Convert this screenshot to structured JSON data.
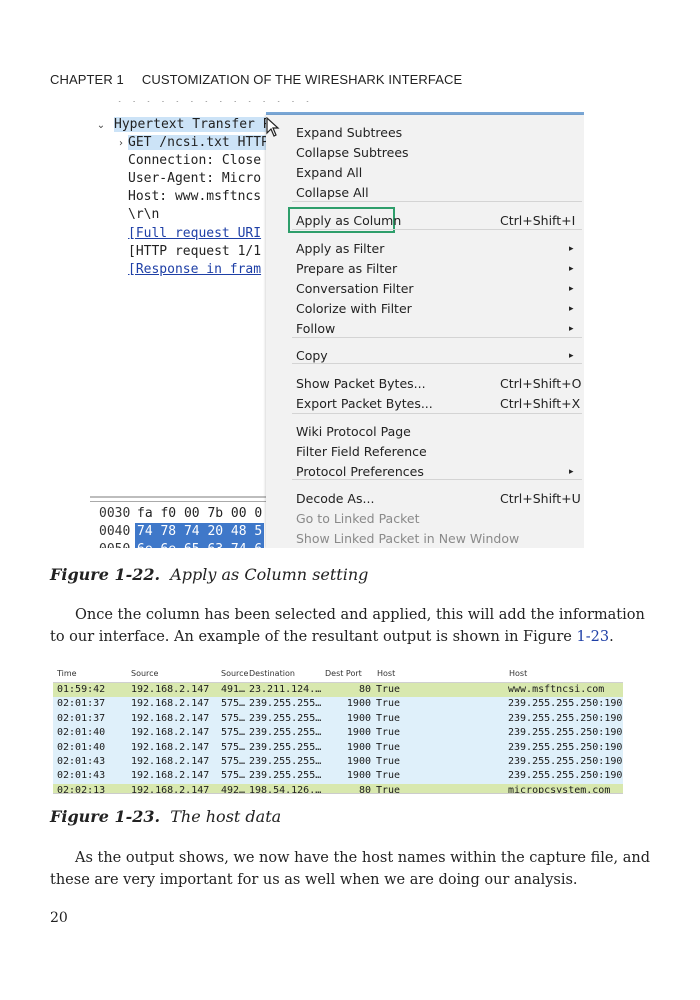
{
  "header": {
    "chapter": "CHAPTER 1",
    "title": "CUSTOMIZATION OF THE WIRESHARK INTERFACE"
  },
  "figure1": {
    "tree_cut_row": "· · · · · · · · · · · · · ·",
    "tree": [
      {
        "arrow": "⌄",
        "text": "Hypertext Transfer P"
      },
      {
        "arrow": "›",
        "text": "GET /ncsi.txt HTTP"
      },
      {
        "arrow": "",
        "text": "Connection: Close"
      },
      {
        "arrow": "",
        "text": "User-Agent: Micro"
      },
      {
        "arrow": "",
        "text": "Host: www.msftncs"
      },
      {
        "arrow": "",
        "text": "\\r\\n"
      },
      {
        "arrow": "",
        "text": "[Full request URI"
      },
      {
        "arrow": "",
        "text": "[HTTP request 1/1"
      },
      {
        "arrow": "",
        "text": "[Response in fram"
      }
    ],
    "hex_rows": [
      {
        "offset": "0030",
        "bytes": "fa f0 00 7b 00 0"
      },
      {
        "offset": "0040",
        "bytes": "74 78 74 20 48 5"
      },
      {
        "offset": "0050",
        "bytes": "6e 6e 65 63 74 6"
      }
    ],
    "menu": {
      "items": [
        {
          "label": "Expand Subtrees",
          "shortcut": "",
          "submenu": ""
        },
        {
          "label": "Collapse Subtrees",
          "shortcut": "",
          "submenu": ""
        },
        {
          "label": "Expand All",
          "shortcut": "",
          "submenu": ""
        },
        {
          "label": "Collapse All",
          "shortcut": "",
          "submenu": ""
        },
        {
          "label": "Apply as Column",
          "shortcut": "Ctrl+Shift+I",
          "submenu": ""
        },
        {
          "label": "Apply as Filter",
          "shortcut": "",
          "submenu": "▸"
        },
        {
          "label": "Prepare as Filter",
          "shortcut": "",
          "submenu": "▸"
        },
        {
          "label": "Conversation Filter",
          "shortcut": "",
          "submenu": "▸"
        },
        {
          "label": "Colorize with Filter",
          "shortcut": "",
          "submenu": "▸"
        },
        {
          "label": "Follow",
          "shortcut": "",
          "submenu": "▸"
        },
        {
          "label": "Copy",
          "shortcut": "",
          "submenu": "▸"
        },
        {
          "label": "Show Packet Bytes...",
          "shortcut": "Ctrl+Shift+O",
          "submenu": ""
        },
        {
          "label": "Export Packet Bytes...",
          "shortcut": "Ctrl+Shift+X",
          "submenu": ""
        },
        {
          "label": "Wiki Protocol Page",
          "shortcut": "",
          "submenu": ""
        },
        {
          "label": "Filter Field Reference",
          "shortcut": "",
          "submenu": ""
        },
        {
          "label": "Protocol Preferences",
          "shortcut": "",
          "submenu": "▸"
        },
        {
          "label": "Decode As...",
          "shortcut": "Ctrl+Shift+U",
          "submenu": ""
        },
        {
          "label": "Go to Linked Packet",
          "shortcut": "",
          "submenu": ""
        },
        {
          "label": "Show Linked Packet in New Window",
          "shortcut": "",
          "submenu": ""
        }
      ],
      "disabled": [
        "Go to Linked Packet",
        "Show Linked Packet in New Window"
      ],
      "highlight_color": "#2e9e6b"
    },
    "caption_num": "Figure 1-22.",
    "caption_text": "Apply as Column setting"
  },
  "paragraph1": {
    "before": "Once the column has been selected and applied, this will add the information to our interface. An example of the resultant output is shown in Figure ",
    "ref": "1-23",
    "after": "."
  },
  "figure2": {
    "columns": [
      "Time",
      "Source",
      "Source",
      "Destination",
      "Dest Port",
      "Host",
      "Host"
    ],
    "rows": [
      [
        "01:59:42",
        "192.168.2.147",
        "491…",
        "23.211.124.…",
        "80",
        "True",
        "www.msftncsi.com"
      ],
      [
        "02:01:37",
        "192.168.2.147",
        "575…",
        "239.255.255…",
        "1900",
        "True",
        "239.255.255.250:1900"
      ],
      [
        "02:01:37",
        "192.168.2.147",
        "575…",
        "239.255.255…",
        "1900",
        "True",
        "239.255.255.250:1900"
      ],
      [
        "02:01:40",
        "192.168.2.147",
        "575…",
        "239.255.255…",
        "1900",
        "True",
        "239.255.255.250:1900"
      ],
      [
        "02:01:40",
        "192.168.2.147",
        "575…",
        "239.255.255…",
        "1900",
        "True",
        "239.255.255.250:1900"
      ],
      [
        "02:01:43",
        "192.168.2.147",
        "575…",
        "239.255.255…",
        "1900",
        "True",
        "239.255.255.250:1900"
      ],
      [
        "02:01:43",
        "192.168.2.147",
        "575…",
        "239.255.255…",
        "1900",
        "True",
        "239.255.255.250:1900"
      ],
      [
        "02:02:13",
        "192.168.2.147",
        "492…",
        "198.54.126.…",
        "80",
        "True",
        "micropcsystem.com"
      ]
    ],
    "row_colors": [
      "#d8e8ae",
      "#dff0fa",
      "#dff0fa",
      "#dff0fa",
      "#dff0fa",
      "#dff0fa",
      "#dff0fa",
      "#d8e8ae"
    ],
    "caption_num": "Figure 1-23.",
    "caption_text": "The host data"
  },
  "paragraph2": "As the output shows, we now have the host names within the capture file, and these are very important for us as well when we are doing our analysis.",
  "page_number": "20"
}
